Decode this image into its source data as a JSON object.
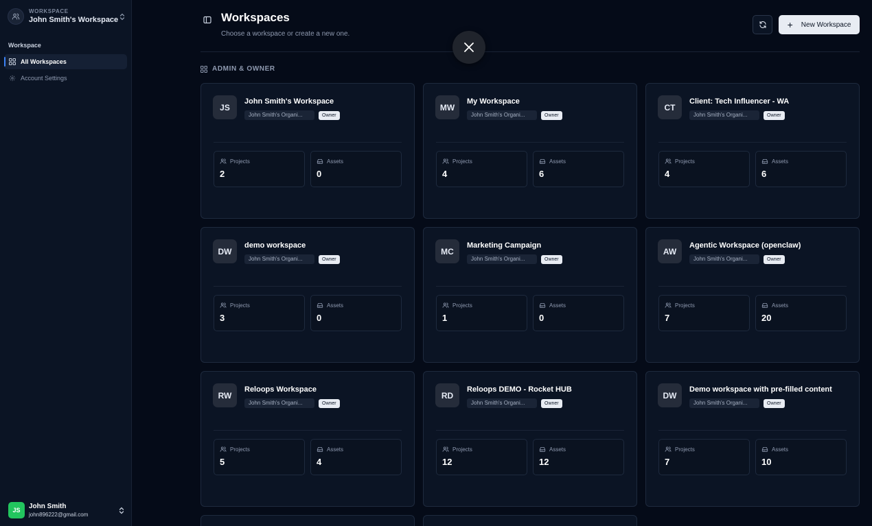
{
  "sidebar": {
    "workspace_caption": "WORKSPACE",
    "workspace_name": "John Smith's Workspace",
    "section_title": "Workspace",
    "items": [
      {
        "label": "All Workspaces",
        "icon": "grid-icon",
        "active": true
      },
      {
        "label": "Account Settings",
        "icon": "gear-icon",
        "active": false
      }
    ],
    "user": {
      "initials": "JS",
      "name": "John Smith",
      "email": "john896222@gmail.com"
    }
  },
  "header": {
    "title": "Workspaces",
    "subtitle": "Choose a workspace or create a new one.",
    "new_button_label": "New Workspace"
  },
  "section": {
    "label": "ADMIN & OWNER"
  },
  "stat_labels": {
    "projects": "Projects",
    "assets": "Assets"
  },
  "workspaces": [
    {
      "initials": "JS",
      "name": "John Smith's Workspace",
      "org": "John Smith's Organi...",
      "role": "Owner",
      "projects": "2",
      "assets": "0"
    },
    {
      "initials": "MW",
      "name": "My Workspace",
      "org": "John Smith's Organi...",
      "role": "Owner",
      "projects": "4",
      "assets": "6"
    },
    {
      "initials": "CT",
      "name": "Client: Tech Influencer - WA",
      "org": "John Smith's Organi...",
      "role": "Owner",
      "projects": "4",
      "assets": "6"
    },
    {
      "initials": "DW",
      "name": "demo workspace",
      "org": "John Smith's Organi...",
      "role": "Owner",
      "projects": "3",
      "assets": "0"
    },
    {
      "initials": "MC",
      "name": "Marketing Campaign",
      "org": "John Smith's Organi...",
      "role": "Owner",
      "projects": "1",
      "assets": "0"
    },
    {
      "initials": "AW",
      "name": "Agentic Workspace (openclaw)",
      "org": "John Smith's Organi...",
      "role": "Owner",
      "projects": "7",
      "assets": "20"
    },
    {
      "initials": "RW",
      "name": "Reloops Workspace",
      "org": "John Smith's Organi...",
      "role": "Owner",
      "projects": "5",
      "assets": "4"
    },
    {
      "initials": "RD",
      "name": "Reloops DEMO - Rocket HUB",
      "org": "John Smith's Organi...",
      "role": "Owner",
      "projects": "12",
      "assets": "12"
    },
    {
      "initials": "DW",
      "name": "Demo workspace with pre-filled content",
      "org": "John Smith's Organi...",
      "role": "Owner",
      "projects": "7",
      "assets": "10"
    }
  ],
  "colors": {
    "accent": "#3b82f6",
    "avatar": "#22c55e",
    "background": "#050b18",
    "card": "#0b1424"
  }
}
